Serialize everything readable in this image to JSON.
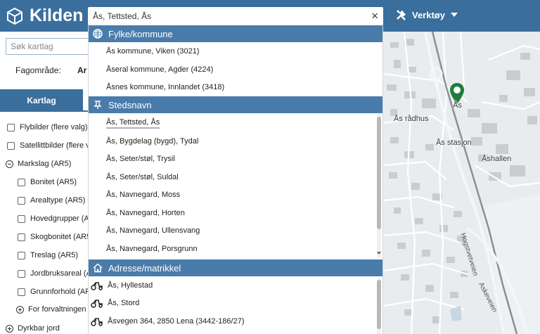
{
  "header": {
    "app_title": "Kilden",
    "tools_label": "Verktøy",
    "search_value": "Ås, Tettsted, Ås",
    "clear_glyph": "×",
    "bg_color": "#3a6e9d"
  },
  "left_panel": {
    "search_placeholder": "Søk kartlag",
    "fagomrade_label": "Fagområde:",
    "fagomrade_value": "Ar",
    "active_tab": "Kartlag",
    "layers": [
      {
        "label": "Flybilder (flere valg)",
        "type": "checkbox"
      },
      {
        "label": "Satellittbilder (flere va",
        "type": "checkbox"
      },
      {
        "label": "Markslag (AR5)",
        "type": "group-expanded"
      },
      {
        "label": "Bonitet (AR5)",
        "type": "checkbox"
      },
      {
        "label": "Arealtype (AR5)",
        "type": "checkbox"
      },
      {
        "label": "Hovedgrupper (AR",
        "type": "checkbox"
      },
      {
        "label": "Skogbonitet (AR5)",
        "type": "checkbox"
      },
      {
        "label": "Treslag (AR5)",
        "type": "checkbox"
      },
      {
        "label": "Jordbruksareal (A",
        "type": "checkbox"
      },
      {
        "label": "Grunnforhold (AR",
        "type": "checkbox"
      },
      {
        "label": "For forvaltningen",
        "type": "group-collapsed"
      },
      {
        "label": "Dyrkbar jord",
        "type": "group-collapsed"
      }
    ]
  },
  "dropdown": {
    "sections": [
      {
        "title": "Fylke/kommune",
        "icon": "globe-icon",
        "items": [
          "Ås kommune, Viken (3021)",
          "Åseral kommune, Agder (4224)",
          "Åsnes kommune, Innlandet (3418)"
        ]
      },
      {
        "title": "Stedsnavn",
        "icon": "pin-icon",
        "items": [
          "Ås, Tettsted, Ås",
          "Ås, Bygdelag (bygd), Tydal",
          "Ås, Seter/støl, Trysil",
          "Ås, Seter/støl, Suldal",
          "Ås, Navnegard, Moss",
          "Ås, Navnegard, Horten",
          "Ås, Navnegard, Ullensvang",
          "Ås, Navnegard, Porsgrunn"
        ]
      },
      {
        "title": "Adresse/matrikkel",
        "icon": "home-icon",
        "items": [
          "Ås, Hyllestad",
          "Ås, Stord",
          "Åsvegen 364, 2850 Lena (3442-186/27)"
        ]
      }
    ]
  },
  "map": {
    "labels": [
      "Ås",
      "Ås rådhus",
      "Ås stasjon",
      "Åshallen"
    ],
    "road_labels": [
      "Hogstvetveien",
      "Askeveien"
    ],
    "marker_color": "#1e7d3c"
  }
}
